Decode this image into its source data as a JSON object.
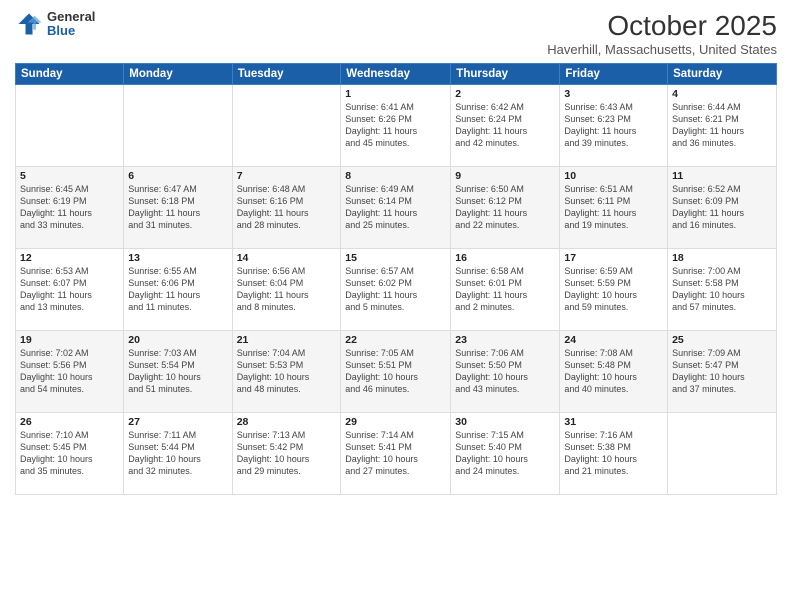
{
  "header": {
    "logo": {
      "general": "General",
      "blue": "Blue"
    },
    "title": "October 2025",
    "location": "Haverhill, Massachusetts, United States"
  },
  "weekdays": [
    "Sunday",
    "Monday",
    "Tuesday",
    "Wednesday",
    "Thursday",
    "Friday",
    "Saturday"
  ],
  "weeks": [
    [
      {
        "day": "",
        "info": ""
      },
      {
        "day": "",
        "info": ""
      },
      {
        "day": "",
        "info": ""
      },
      {
        "day": "1",
        "info": "Sunrise: 6:41 AM\nSunset: 6:26 PM\nDaylight: 11 hours\nand 45 minutes."
      },
      {
        "day": "2",
        "info": "Sunrise: 6:42 AM\nSunset: 6:24 PM\nDaylight: 11 hours\nand 42 minutes."
      },
      {
        "day": "3",
        "info": "Sunrise: 6:43 AM\nSunset: 6:23 PM\nDaylight: 11 hours\nand 39 minutes."
      },
      {
        "day": "4",
        "info": "Sunrise: 6:44 AM\nSunset: 6:21 PM\nDaylight: 11 hours\nand 36 minutes."
      }
    ],
    [
      {
        "day": "5",
        "info": "Sunrise: 6:45 AM\nSunset: 6:19 PM\nDaylight: 11 hours\nand 33 minutes."
      },
      {
        "day": "6",
        "info": "Sunrise: 6:47 AM\nSunset: 6:18 PM\nDaylight: 11 hours\nand 31 minutes."
      },
      {
        "day": "7",
        "info": "Sunrise: 6:48 AM\nSunset: 6:16 PM\nDaylight: 11 hours\nand 28 minutes."
      },
      {
        "day": "8",
        "info": "Sunrise: 6:49 AM\nSunset: 6:14 PM\nDaylight: 11 hours\nand 25 minutes."
      },
      {
        "day": "9",
        "info": "Sunrise: 6:50 AM\nSunset: 6:12 PM\nDaylight: 11 hours\nand 22 minutes."
      },
      {
        "day": "10",
        "info": "Sunrise: 6:51 AM\nSunset: 6:11 PM\nDaylight: 11 hours\nand 19 minutes."
      },
      {
        "day": "11",
        "info": "Sunrise: 6:52 AM\nSunset: 6:09 PM\nDaylight: 11 hours\nand 16 minutes."
      }
    ],
    [
      {
        "day": "12",
        "info": "Sunrise: 6:53 AM\nSunset: 6:07 PM\nDaylight: 11 hours\nand 13 minutes."
      },
      {
        "day": "13",
        "info": "Sunrise: 6:55 AM\nSunset: 6:06 PM\nDaylight: 11 hours\nand 11 minutes."
      },
      {
        "day": "14",
        "info": "Sunrise: 6:56 AM\nSunset: 6:04 PM\nDaylight: 11 hours\nand 8 minutes."
      },
      {
        "day": "15",
        "info": "Sunrise: 6:57 AM\nSunset: 6:02 PM\nDaylight: 11 hours\nand 5 minutes."
      },
      {
        "day": "16",
        "info": "Sunrise: 6:58 AM\nSunset: 6:01 PM\nDaylight: 11 hours\nand 2 minutes."
      },
      {
        "day": "17",
        "info": "Sunrise: 6:59 AM\nSunset: 5:59 PM\nDaylight: 10 hours\nand 59 minutes."
      },
      {
        "day": "18",
        "info": "Sunrise: 7:00 AM\nSunset: 5:58 PM\nDaylight: 10 hours\nand 57 minutes."
      }
    ],
    [
      {
        "day": "19",
        "info": "Sunrise: 7:02 AM\nSunset: 5:56 PM\nDaylight: 10 hours\nand 54 minutes."
      },
      {
        "day": "20",
        "info": "Sunrise: 7:03 AM\nSunset: 5:54 PM\nDaylight: 10 hours\nand 51 minutes."
      },
      {
        "day": "21",
        "info": "Sunrise: 7:04 AM\nSunset: 5:53 PM\nDaylight: 10 hours\nand 48 minutes."
      },
      {
        "day": "22",
        "info": "Sunrise: 7:05 AM\nSunset: 5:51 PM\nDaylight: 10 hours\nand 46 minutes."
      },
      {
        "day": "23",
        "info": "Sunrise: 7:06 AM\nSunset: 5:50 PM\nDaylight: 10 hours\nand 43 minutes."
      },
      {
        "day": "24",
        "info": "Sunrise: 7:08 AM\nSunset: 5:48 PM\nDaylight: 10 hours\nand 40 minutes."
      },
      {
        "day": "25",
        "info": "Sunrise: 7:09 AM\nSunset: 5:47 PM\nDaylight: 10 hours\nand 37 minutes."
      }
    ],
    [
      {
        "day": "26",
        "info": "Sunrise: 7:10 AM\nSunset: 5:45 PM\nDaylight: 10 hours\nand 35 minutes."
      },
      {
        "day": "27",
        "info": "Sunrise: 7:11 AM\nSunset: 5:44 PM\nDaylight: 10 hours\nand 32 minutes."
      },
      {
        "day": "28",
        "info": "Sunrise: 7:13 AM\nSunset: 5:42 PM\nDaylight: 10 hours\nand 29 minutes."
      },
      {
        "day": "29",
        "info": "Sunrise: 7:14 AM\nSunset: 5:41 PM\nDaylight: 10 hours\nand 27 minutes."
      },
      {
        "day": "30",
        "info": "Sunrise: 7:15 AM\nSunset: 5:40 PM\nDaylight: 10 hours\nand 24 minutes."
      },
      {
        "day": "31",
        "info": "Sunrise: 7:16 AM\nSunset: 5:38 PM\nDaylight: 10 hours\nand 21 minutes."
      },
      {
        "day": "",
        "info": ""
      }
    ]
  ]
}
